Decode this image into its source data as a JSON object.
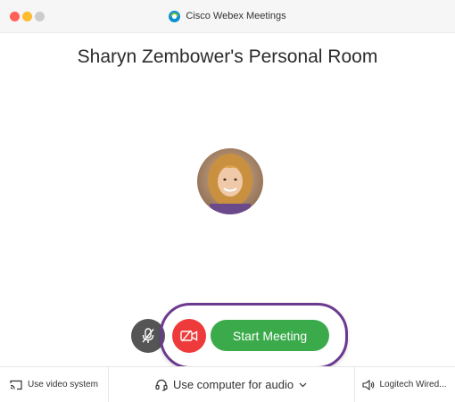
{
  "window": {
    "title": "Cisco Webex Meetings",
    "app_icon": "webex-logo"
  },
  "room": {
    "title": "Sharyn Zembower's Personal Room"
  },
  "controls": {
    "mute_icon": "microphone-muted-icon",
    "video_icon": "video-off-icon",
    "start_label": "Start Meeting"
  },
  "bottom_bar": {
    "video_system_label": "Use video system",
    "audio_label": "Use computer for audio",
    "speaker_label": "Logitech Wired..."
  },
  "colors": {
    "start_button": "#3aaa4a",
    "video_button": "#ee3a3a",
    "mute_button": "#555555",
    "highlight_ring": "#6b3a8f"
  }
}
